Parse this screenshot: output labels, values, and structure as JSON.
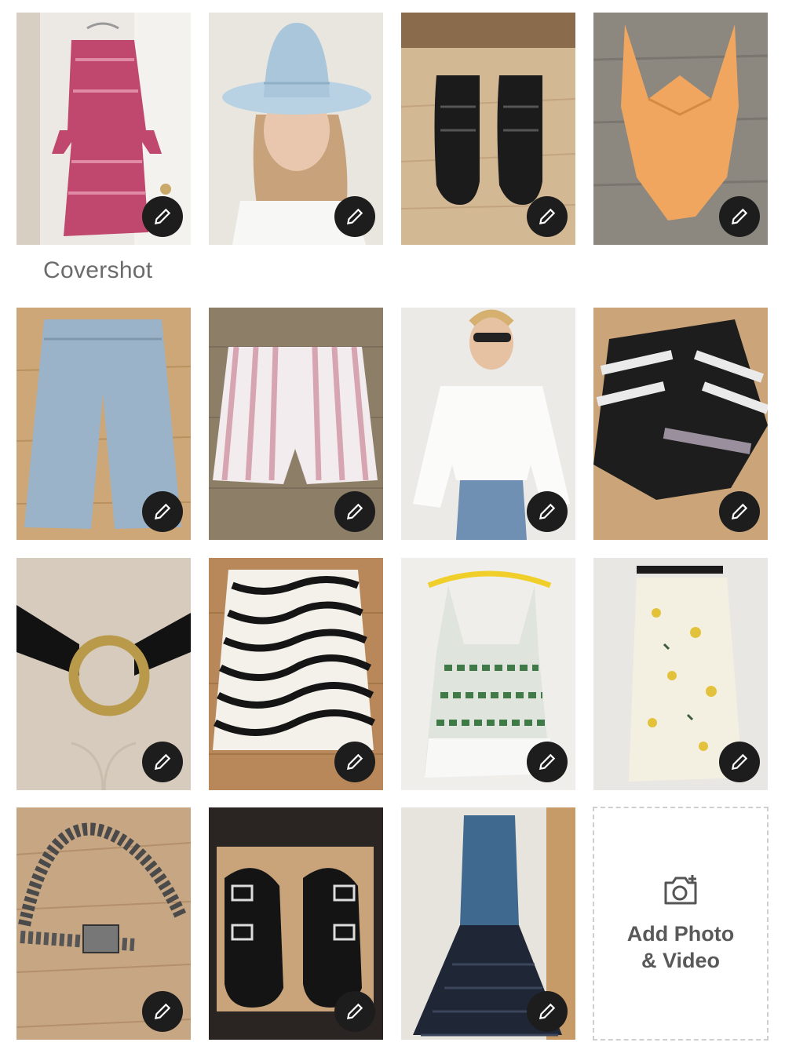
{
  "grid": {
    "covershot_label": "Covershot",
    "add_tile": {
      "label_line1": "Add Photo",
      "label_line2": "& Video",
      "icon": "camera-plus-icon"
    },
    "edit_icon": "pencil-icon",
    "photos": [
      {
        "subject": "pink-dress"
      },
      {
        "subject": "woman-in-hat"
      },
      {
        "subject": "black-sandals"
      },
      {
        "subject": "orange-swimsuit"
      },
      {
        "subject": "wide-leg-jeans"
      },
      {
        "subject": "striped-shorts"
      },
      {
        "subject": "white-tie-blouse"
      },
      {
        "subject": "striped-cardigan"
      },
      {
        "subject": "ring-belt"
      },
      {
        "subject": "zebra-skirt"
      },
      {
        "subject": "lace-top"
      },
      {
        "subject": "floral-slip-skirt"
      },
      {
        "subject": "chain-belt"
      },
      {
        "subject": "buckle-slides"
      },
      {
        "subject": "denim-dress"
      }
    ]
  },
  "colors": {
    "edit_button": "#1d1d1d",
    "label_text": "#6b6b6b",
    "add_text": "#595959",
    "dashed_border": "#cfcfcf"
  }
}
